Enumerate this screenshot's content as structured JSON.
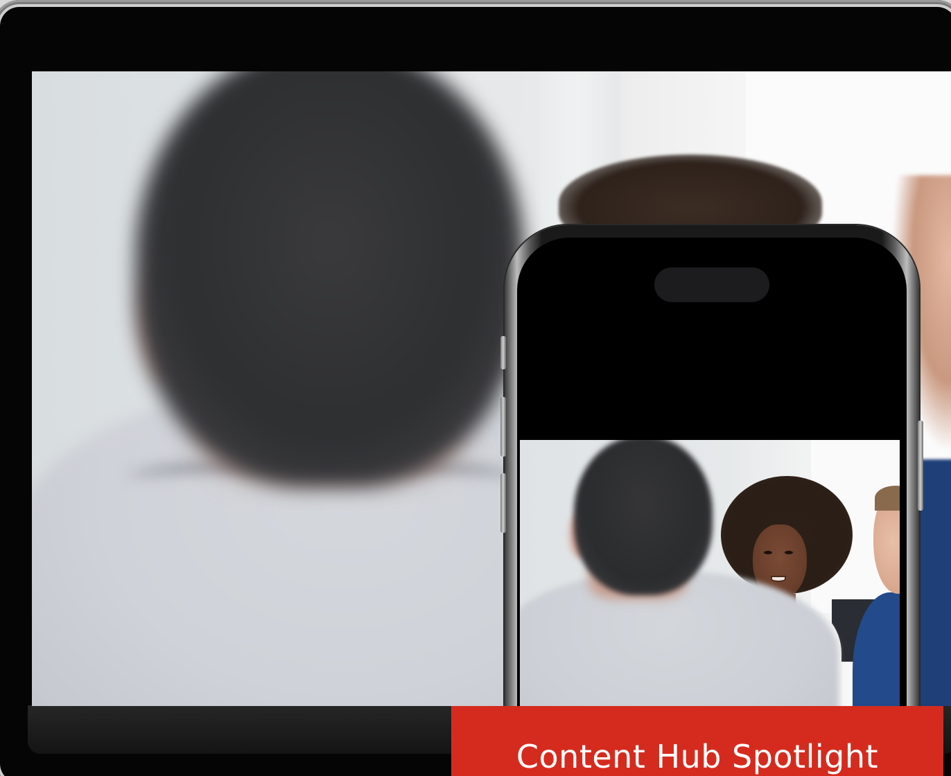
{
  "banner": {
    "title": "Content Hub Spotlight",
    "background_color": "#d52b1e",
    "text_color": "#ffffff"
  },
  "devices": {
    "primary": "laptop-screen",
    "secondary": "smartphone"
  }
}
